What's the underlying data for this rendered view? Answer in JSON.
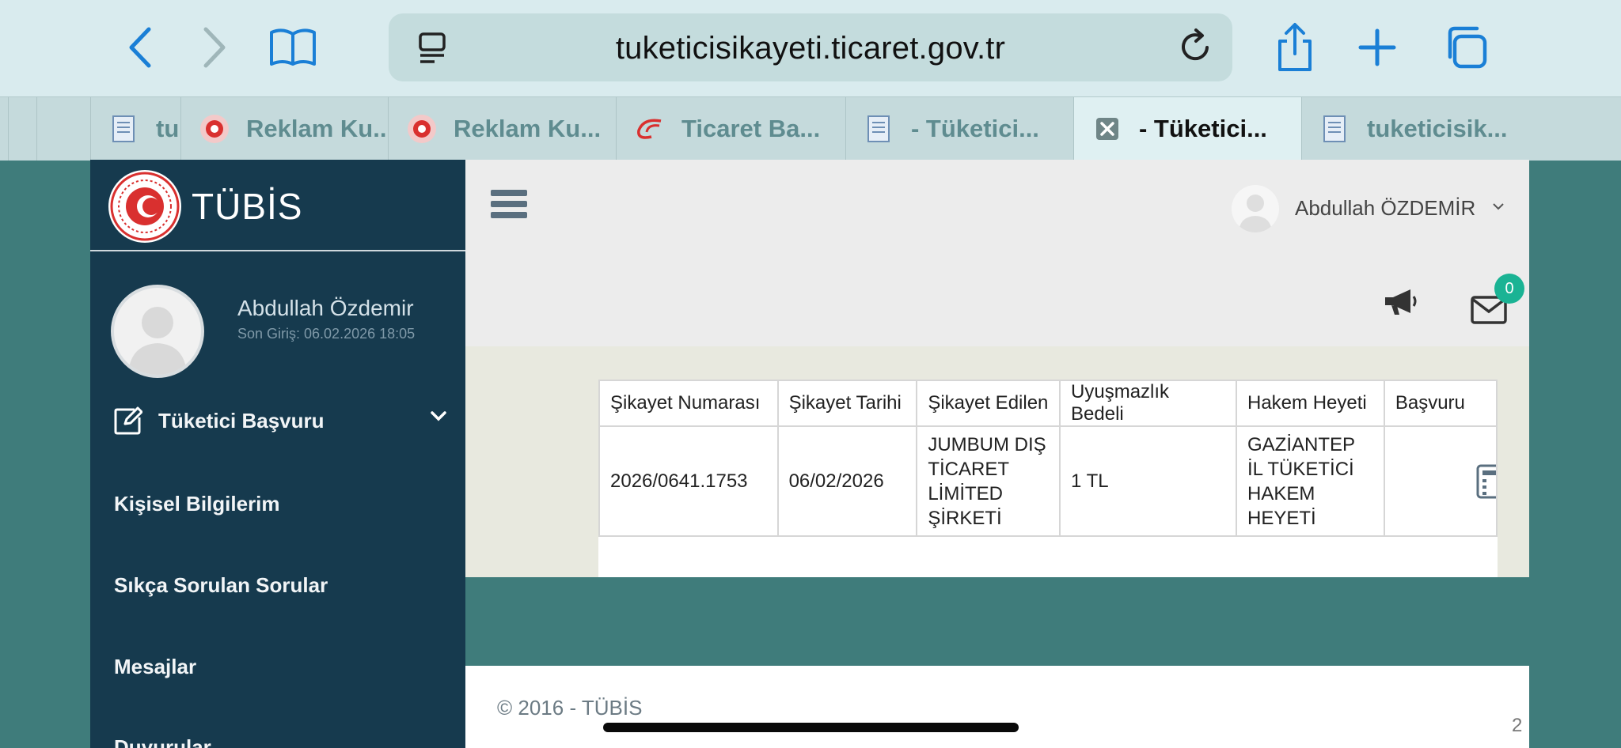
{
  "browser": {
    "url": "tuketicisikayeti.ticaret.gov.tr",
    "tabs": [
      {
        "label": "tu",
        "icon": "document-icon"
      },
      {
        "label": "Reklam Ku...",
        "icon": "seal-icon"
      },
      {
        "label": "Reklam Ku...",
        "icon": "seal-icon"
      },
      {
        "label": "Ticaret Ba...",
        "icon": "ministry-logo-icon"
      },
      {
        "label": "- Tüketici...",
        "icon": "document-icon"
      },
      {
        "label": "- Tüketici...",
        "icon": "close-icon",
        "active": true
      },
      {
        "label": "tuketicisik...",
        "icon": "document-icon"
      }
    ]
  },
  "app": {
    "brand": "TÜBİS",
    "profile": {
      "name": "Abdullah Özdemir",
      "last_login": "Son Giriş: 06.02.2026 18:05"
    },
    "menu": [
      "Tüketici Başvuru",
      "Kişisel Bilgilerim",
      "Sıkça Sorulan Sorular",
      "Mesajlar",
      "Duyurular"
    ],
    "header": {
      "user_name": "Abdullah ÖZDEMİR",
      "mail_count": "0"
    },
    "table": {
      "columns": [
        "Şikayet Numarası",
        "Şikayet Tarihi",
        "Şikayet Edilen",
        "Uyuşmazlık Bedeli",
        "Hakem Heyeti",
        "Başvuru"
      ],
      "rows": [
        {
          "number": "2026/0641.1753",
          "date": "06/02/2026",
          "company": [
            "JUMBUM DIŞ",
            "TİCARET",
            "LİMİTED",
            "ŞİRKETİ"
          ],
          "amount": "1 TL",
          "committee": [
            "GAZİANTEP",
            "İL TÜKETİCİ",
            "HAKEM",
            "HEYETİ"
          ]
        }
      ]
    },
    "footer": "© 2016 - TÜBİS",
    "page_number": "2"
  },
  "colors": {
    "sidebar": "#163a4e",
    "page_bg": "#3f7c7b",
    "badge": "#1ab394",
    "accent_blue": "#1a7fd6"
  }
}
